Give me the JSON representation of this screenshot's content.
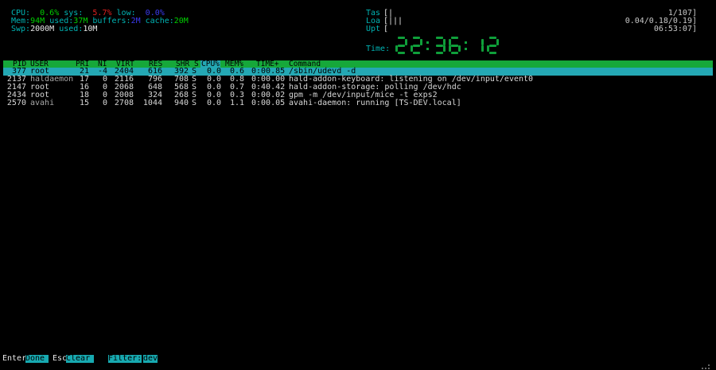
{
  "meters": {
    "cpu": {
      "label": "CPU:",
      "user": "0.6%",
      "sys_label": "sys:",
      "sys": "5.7%",
      "low_label": "low:",
      "low": "0.0%"
    },
    "mem": {
      "label": "Mem:",
      "total": "94M",
      "used_label": "used:",
      "used": "37M",
      "buffers_label": "buffers:",
      "buffers": "2M",
      "cache_label": "cache:",
      "cache": "20M"
    },
    "swp": {
      "label": "Swp:",
      "total": "2000M",
      "used_label": "used:",
      "used": "10M"
    }
  },
  "right_meters": {
    "tasks": {
      "label": "Tas",
      "bar": "[|",
      "value": "1/107]"
    },
    "load": {
      "label": "Loa",
      "bar": "[|||",
      "value": "0.04/0.18/0.19]"
    },
    "uptime": {
      "label": "Upt",
      "bar": "[",
      "value": "06:53:07]"
    },
    "time_label": "Time:",
    "clock": "22:36:12"
  },
  "columns": [
    "PID",
    "USER",
    "PRI",
    "NI",
    "VIRT",
    "RES",
    "SHR",
    "S",
    "CPU%",
    "MEM%",
    "TIME+",
    "Command"
  ],
  "processes": [
    {
      "pid": "377",
      "user": "root",
      "pri": "21",
      "ni": "-4",
      "virt": "2404",
      "res": "616",
      "shr": "392",
      "s": "S",
      "cpu": "0.0",
      "mem": "0.6",
      "time": "0:00.85",
      "cmd": "/sbin/udevd -d"
    },
    {
      "pid": "2137",
      "user": "haldaemon",
      "pri": "17",
      "ni": "0",
      "virt": "2116",
      "res": "796",
      "shr": "708",
      "s": "S",
      "cpu": "0.0",
      "mem": "0.8",
      "time": "0:00.00",
      "cmd": "hald-addon-keyboard: listening on /dev/input/event0"
    },
    {
      "pid": "2147",
      "user": "root",
      "pri": "16",
      "ni": "0",
      "virt": "2068",
      "res": "648",
      "shr": "568",
      "s": "S",
      "cpu": "0.0",
      "mem": "0.7",
      "time": "0:40.42",
      "cmd": "hald-addon-storage: polling /dev/hdc"
    },
    {
      "pid": "2434",
      "user": "root",
      "pri": "18",
      "ni": "0",
      "virt": "2008",
      "res": "324",
      "shr": "268",
      "s": "S",
      "cpu": "0.0",
      "mem": "0.3",
      "time": "0:00.02",
      "cmd": "gpm -m /dev/input/mice -t exps2"
    },
    {
      "pid": "2570",
      "user": "avahi",
      "pri": "15",
      "ni": "0",
      "virt": "2708",
      "res": "1044",
      "shr": "940",
      "s": "S",
      "cpu": "0.0",
      "mem": "1.1",
      "time": "0:00.05",
      "cmd": "avahi-daemon: running [TS-DEV.local]"
    }
  ],
  "footer": {
    "enter_key": "Enter",
    "enter_action": "Done",
    "esc_key": "Esc",
    "esc_action": "Clear",
    "filter_label": "Filter:",
    "filter_value": "dev"
  },
  "colors": {
    "cyan": "#00b4b4",
    "green": "#16a83a",
    "selection": "#24a8b4",
    "background": "#000000"
  }
}
